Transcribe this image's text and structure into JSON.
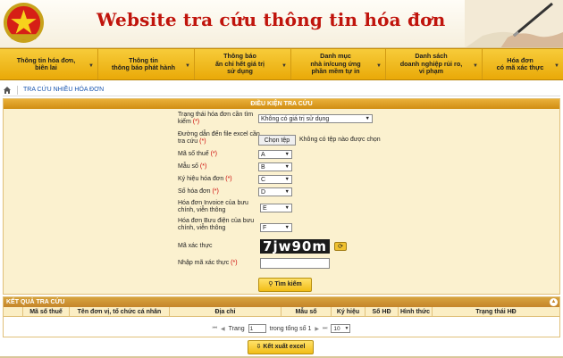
{
  "header": {
    "title": "Website tra cứu thông tin hóa đơn",
    "logo_text": "THUẾ NHÀ NƯỚC"
  },
  "nav": {
    "items": [
      {
        "label": "Thông tin hóa đơn,\nbiên lai"
      },
      {
        "label": "Thông tin\nthông báo phát hành"
      },
      {
        "label": "Thông báo\nấn chỉ hết giá trị\nsử dụng"
      },
      {
        "label": "Danh mục\nnhà in/cung ứng\nphần mềm tự in"
      },
      {
        "label": "Danh sách\ndoanh nghiệp rủi ro,\nvi phạm"
      },
      {
        "label": "Hóa đơn\ncó mã xác thực"
      }
    ]
  },
  "breadcrumb": {
    "current": "TRA CỨU NHIỀU HÓA ĐƠN"
  },
  "search_panel": {
    "title": "ĐIỀU KIỆN TRA CỨU",
    "status_label": "Trạng thái hóa đơn cần tìm kiếm",
    "status_value": "Không có giá trị sử dụng",
    "file_label": "Đường dẫn đến file excel cần tra cứu",
    "file_button": "Chọn tệp",
    "file_status": "Không có tệp nào được chọn",
    "fields": [
      {
        "label": "Mã số thuế",
        "value": "A"
      },
      {
        "label": "Mẫu số",
        "value": "B"
      },
      {
        "label": "Ký hiệu hóa đơn",
        "value": "C"
      },
      {
        "label": "Số hóa đơn",
        "value": "D"
      },
      {
        "label": "Hóa đơn Invoice của bưu chính, viễn thông",
        "value": "E"
      },
      {
        "label": "Hóa đơn Bưu điện của bưu chính, viễn thông",
        "value": "F"
      }
    ],
    "captcha_label": "Mã xác thực",
    "captcha_value": "7jw90m",
    "captcha_input_label": "Nhập mã xác thực",
    "captcha_input_value": "",
    "search_button": "Tìm kiếm",
    "required_mark": "(*)"
  },
  "results": {
    "title": "KẾT QUẢ TRA CỨU",
    "columns": [
      "Mã số thuế",
      "Tên đơn vị, tổ chức cá nhân",
      "Địa chỉ",
      "Mẫu số",
      "Ký hiệu",
      "Số HĐ",
      "Hình thức",
      "Trạng thái HĐ"
    ],
    "pager": {
      "page_label": "Trang",
      "page_value": "1",
      "total_label": "trong tổng số 1",
      "page_size": "10"
    },
    "export_button": "Kết xuất excel"
  },
  "colors": {
    "brand_red": "#c0140c",
    "nav_gold": "#e9a908",
    "panel_bg": "#fbf1cf",
    "link_blue": "#1a56b0"
  }
}
